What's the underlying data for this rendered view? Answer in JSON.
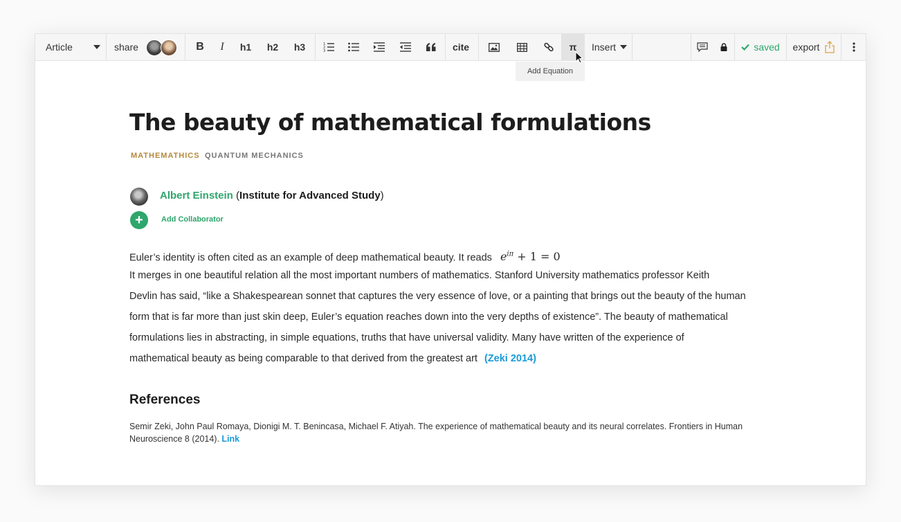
{
  "toolbar": {
    "doc_type": "Article",
    "share_label": "share",
    "bold": "B",
    "italic": "I",
    "h1": "h1",
    "h2": "h2",
    "h3": "h3",
    "cite": "cite",
    "pi": "π",
    "insert": "Insert",
    "saved": "saved",
    "export": "export",
    "tooltip": "Add Equation"
  },
  "article": {
    "title": "The beauty of mathematical formulations",
    "tags": [
      "MATHEMATHICS",
      "QUANTUM MECHANICS"
    ],
    "author": {
      "name": "Albert Einstein",
      "affiliation": "Institute for Advanced Study"
    },
    "add_collaborator": "Add Collaborator",
    "body": {
      "line1": "Euler’s identity is often cited as an example of deep mathematical beauty. It reads",
      "equation_base": "e",
      "equation_exp": "iπ",
      "equation_rest": " + 1 = 0",
      "line2": "It merges in one beautiful relation all the most important numbers of mathematics.  Stanford University mathematics professor Keith",
      "line3": "Devlin has said, “like a Shakespearean sonnet that captures the very essence of love, or a painting that brings out the beauty of the human",
      "line4": "form that is far more than just skin deep, Euler’s equation reaches down into the very depths of existence”.  The beauty of mathematical",
      "line5": "formulations lies in abstracting, in simple equations, truths that have universal validity. Many have written of the experience of",
      "line6": "mathematical beauty as being comparable to that derived from the greatest art",
      "citation": "(Zeki 2014)"
    },
    "references_heading": "References",
    "reference_text": "Semir Zeki, John Paul Romaya, Dionigi M. T. Benincasa, Michael F. Atiyah. The experience of mathematical beauty and its neural correlates. Frontiers in Human Neuroscience 8 (2014).",
    "reference_link": "Link"
  },
  "colors": {
    "accent_green": "#2ea66c",
    "link_blue": "#1a9ad6",
    "tag_gold": "#b58a3c",
    "tag_gray": "#777777"
  }
}
